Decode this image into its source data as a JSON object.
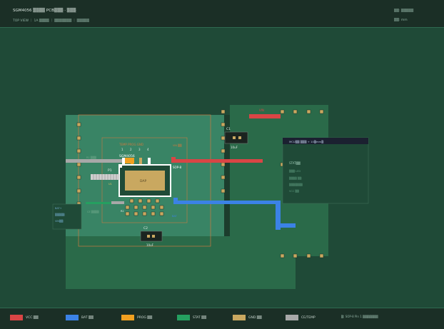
{
  "header": {
    "title": "SGM4056 ▒▒▒▒ PCB▒▒▒ · ▒▒▒",
    "subtitle": "TOP VIEW ｜ 1A ▒▒▒▒ ｜ ▒▒▒▒▒▒▒ ｜ ▒▒▒▒▒",
    "right_top": "▒▒: ▒▒▒▒▒",
    "right_bottom": "▒▒: mm"
  },
  "board": {
    "chip_name": "SGM4056",
    "package": "SOP-8",
    "dap_label": "DAP",
    "top_pin_header": "TEMP PROG GND",
    "top_pin_numbers": [
      "1",
      "2",
      "3",
      "4"
    ],
    "p1_label": "P1",
    "left_label_1": "R1 ▒▒▒",
    "left_label_2": "U1",
    "left_label_3": "R2",
    "left_label_4": "CE ▒▒▒▒",
    "conn_label_1": "BAT+",
    "conn_label_2": "▒▒▒▒▒",
    "conn_label_3": "VIN▒▒",
    "c1_label": "C1",
    "c1_value": "10uF",
    "c2_label": "C2",
    "c2_value": "10uF",
    "tp_label": "VIN ▒▒",
    "red_pad_label": "VIN",
    "blue_pad_label": "BAT",
    "right_box_title": "MCU▒▒ ▒▒▒ + 10▒mm▒",
    "right_box_lines": [
      "STAT▒▒",
      "▒▒▒ LED",
      "▒▒▒▒ ▒▒",
      "▒▒▒▒▒▒▒",
      "VCC ▒▒"
    ]
  },
  "legend": [
    {
      "label": "VCC ▒▒",
      "color": "#d94545"
    },
    {
      "label": "BAT ▒▒",
      "color": "#3b82e6"
    },
    {
      "label": "PROG ▒▒",
      "color": "#f0a020"
    },
    {
      "label": "STAT ▒▒",
      "color": "#25a060"
    },
    {
      "label": "GND ▒▒",
      "color": "#c9a860"
    },
    {
      "label": "CE/TEMP",
      "color": "#a8a8a8"
    }
  ],
  "legend_note": "▒: SOP-8 Pin 1 ▒▒▒▒▒▒▒"
}
